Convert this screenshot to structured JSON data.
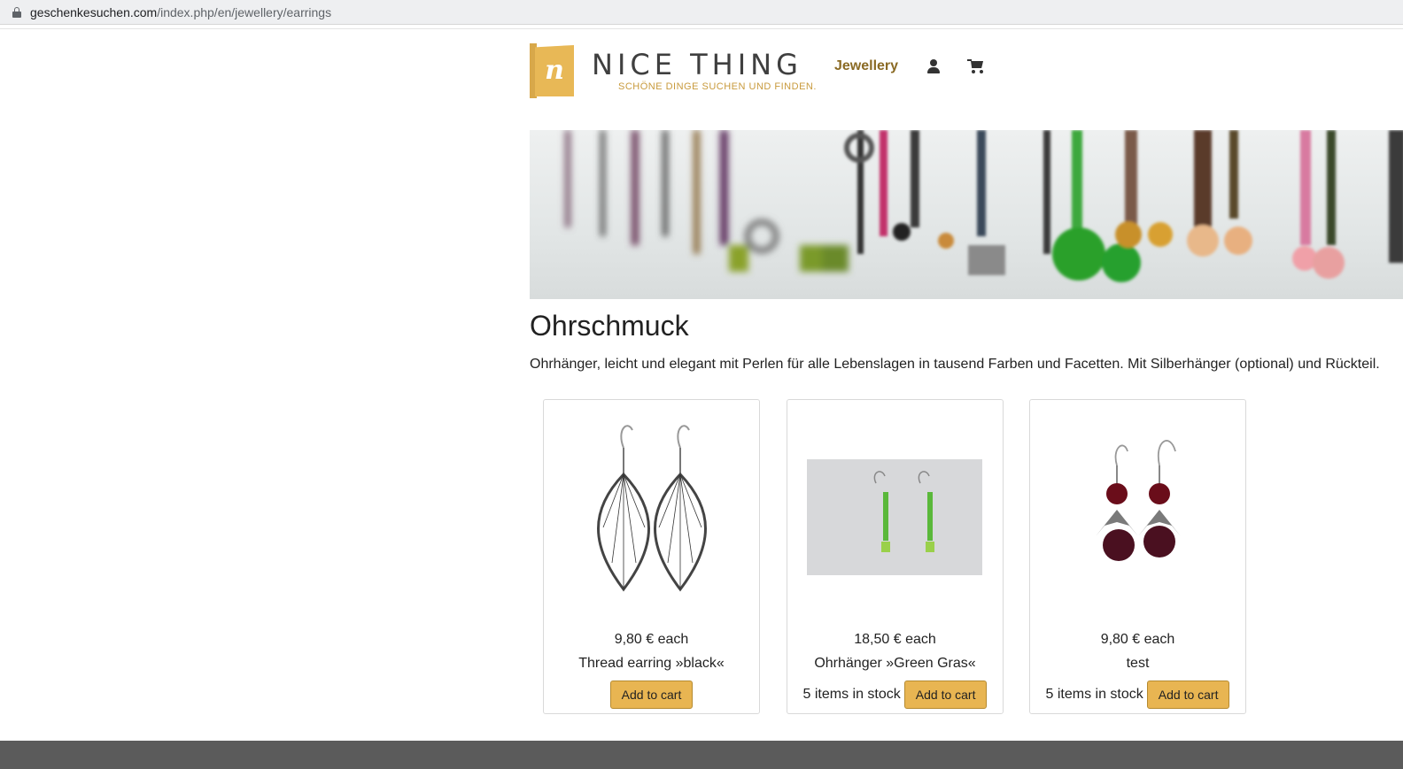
{
  "browser": {
    "url_domain": "geschenkesuchen.com",
    "url_path": "/index.php/en/jewellery/earrings"
  },
  "header": {
    "logo_letter": "n",
    "logo_name": "NICE THING",
    "logo_tagline": "SCHÖNE DINGE SUCHEN UND FINDEN.",
    "nav_link": "Jewellery",
    "user_icon": "user-icon",
    "cart_icon": "cart-icon"
  },
  "page": {
    "title": "Ohrschmuck",
    "description": "Ohrhänger, leicht und elegant mit Perlen für alle Lebenslagen in tausend Farben und Facetten. Mit Silberhänger (optional) und Rückteil."
  },
  "products": [
    {
      "price": "9,80 € each",
      "name": "Thread earring »black«",
      "stock": "",
      "button": "Add to cart"
    },
    {
      "price": "18,50 € each",
      "name": "Ohrhänger »Green Gras«",
      "stock": "5 items in stock",
      "button": "Add to cart"
    },
    {
      "price": "9,80 € each",
      "name": "test",
      "stock": "5 items in stock",
      "button": "Add to cart"
    }
  ],
  "colors": {
    "accent": "#e8b552",
    "nav_link": "#8a6a24",
    "footer": "#5b5b5b"
  }
}
